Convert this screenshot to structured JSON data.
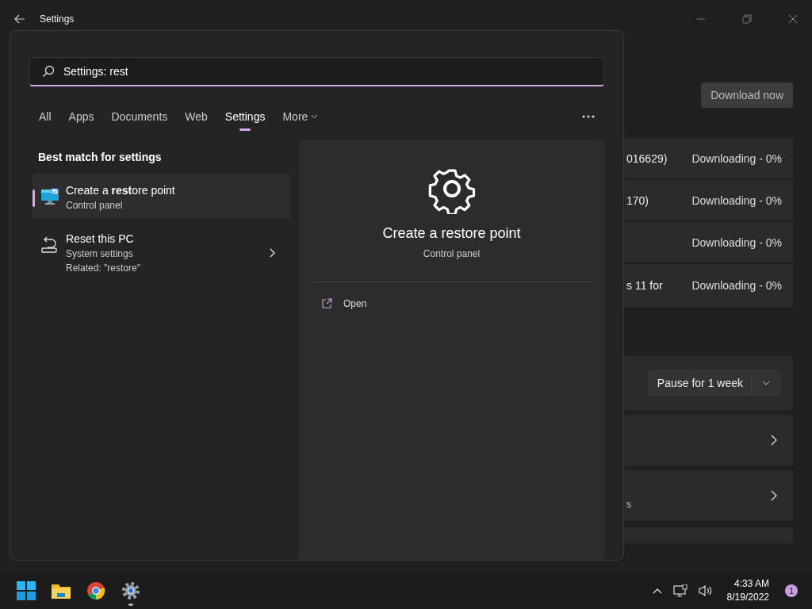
{
  "window": {
    "title": "Settings"
  },
  "background": {
    "download_button": "Download now",
    "updates": [
      {
        "name": "016629)",
        "status": "Downloading - 0%"
      },
      {
        "name": "170)",
        "status": "Downloading - 0%"
      },
      {
        "status": "Downloading - 0%"
      },
      {
        "name": "s 11 for",
        "status": "Downloading - 0%"
      }
    ],
    "pause": {
      "label": "Pause for 1 week"
    },
    "option_rows": [
      {
        "kind": "link"
      },
      {
        "kind": "link",
        "text": "s"
      }
    ]
  },
  "search": {
    "query": "Settings: rest"
  },
  "tabs": [
    {
      "label": "All",
      "selected": false,
      "menu": false
    },
    {
      "label": "Apps",
      "selected": false,
      "menu": false
    },
    {
      "label": "Documents",
      "selected": false,
      "menu": false
    },
    {
      "label": "Web",
      "selected": false,
      "menu": false
    },
    {
      "label": "Settings",
      "selected": true,
      "menu": false
    },
    {
      "label": "More",
      "selected": false,
      "menu": true
    }
  ],
  "results": {
    "heading": "Best match for settings",
    "items": [
      {
        "kind": "control-panel",
        "title": "Create a **rest**ore point",
        "subtitle": "Control panel",
        "selected": true,
        "chevron": false
      },
      {
        "kind": "system",
        "title": "Reset this PC",
        "subtitle": "System settings",
        "related": "Related: \"restore\"",
        "selected": false,
        "chevron": true
      }
    ]
  },
  "preview": {
    "title": "Create a restore point",
    "subtitle": "Control panel",
    "actions": [
      {
        "label": "Open"
      }
    ]
  },
  "taskbar": {
    "apps": [
      {
        "kind": "start",
        "running": false
      },
      {
        "kind": "folder",
        "running": false
      },
      {
        "kind": "browser",
        "running": false
      },
      {
        "kind": "settings",
        "running": true
      }
    ],
    "clock": {
      "time": "4:33 AM",
      "date": "8/19/2022"
    },
    "notifications": "1"
  }
}
